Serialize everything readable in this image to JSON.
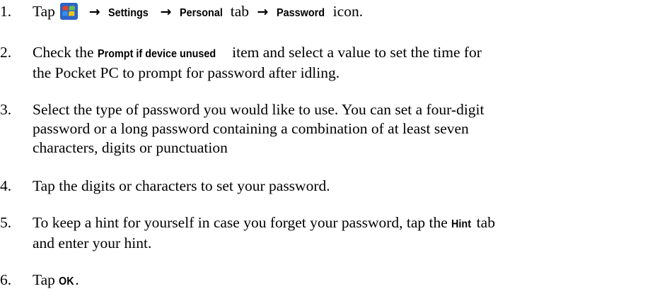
{
  "steps": [
    {
      "number": "1.",
      "lead": "Tap",
      "settings": "Settings",
      "personal": "Personal",
      "tab_word": "tab",
      "password": "Password",
      "icon_word": "icon."
    },
    {
      "number": "2.",
      "pre": "Check the",
      "bold": "Prompt if device unused",
      "post": "item and select a value to set the time for",
      "line2": "the Pocket PC to prompt for password after idling."
    },
    {
      "number": "3.",
      "line1": "Select the type of password you would like to use. You can set a four-digit",
      "line2": "password or a long password containing a combination of at least seven",
      "line3": "characters, digits or punctuation"
    },
    {
      "number": "4.",
      "line1": "Tap the digits or characters to set your password."
    },
    {
      "number": "5.",
      "pre": "To keep a hint for yourself in case you forget your password, tap the",
      "bold": "Hint",
      "post": "tab",
      "line2": "and enter your hint."
    },
    {
      "number": "6.",
      "pre": "Tap",
      "bold": "OK",
      "post": "."
    }
  ],
  "arrow_glyph": "→",
  "icons": {
    "start": "windows-start-icon"
  },
  "colors": {
    "text": "#000000",
    "background": "#ffffff"
  }
}
